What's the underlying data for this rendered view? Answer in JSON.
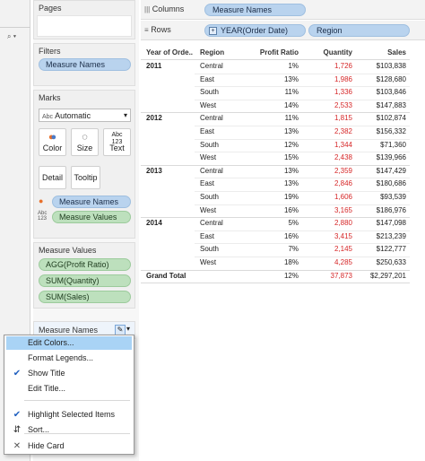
{
  "columns_shelf": {
    "label": "Columns",
    "pills": [
      "Measure Names"
    ]
  },
  "rows_shelf": {
    "label": "Rows",
    "pills": [
      "YEAR(Order Date)",
      "Region"
    ]
  },
  "cards": {
    "pages": {
      "title": "Pages"
    },
    "filters": {
      "title": "Filters",
      "pills": [
        "Measure Names"
      ]
    },
    "marks": {
      "title": "Marks",
      "mark_type": "Automatic",
      "mark_type_prefix": "Abc",
      "buttons": [
        "Color",
        "Size",
        "Text",
        "Detail",
        "Tooltip"
      ],
      "fields": [
        {
          "icon": "color-icon",
          "name": "Measure Names",
          "kind": "blue"
        },
        {
          "icon": "abc-icon",
          "name": "Measure Values",
          "kind": "green"
        }
      ]
    },
    "measure_values": {
      "title": "Measure Values",
      "pills": [
        "AGG(Profit Ratio)",
        "SUM(Quantity)",
        "SUM(Sales)"
      ]
    },
    "measure_names_legend": {
      "title": "Measure Names"
    }
  },
  "table": {
    "headers": [
      "Year of Orde..",
      "Region",
      "Profit Ratio",
      "Quantity",
      "Sales"
    ],
    "groups": [
      {
        "year": "2011",
        "rows": [
          {
            "region": "Central",
            "profit": "1%",
            "qty": "1,726",
            "sales": "$103,838"
          },
          {
            "region": "East",
            "profit": "13%",
            "qty": "1,986",
            "sales": "$128,680"
          },
          {
            "region": "South",
            "profit": "11%",
            "qty": "1,336",
            "sales": "$103,846"
          },
          {
            "region": "West",
            "profit": "14%",
            "qty": "2,533",
            "sales": "$147,883"
          }
        ]
      },
      {
        "year": "2012",
        "rows": [
          {
            "region": "Central",
            "profit": "11%",
            "qty": "1,815",
            "sales": "$102,874"
          },
          {
            "region": "East",
            "profit": "13%",
            "qty": "2,382",
            "sales": "$156,332"
          },
          {
            "region": "South",
            "profit": "12%",
            "qty": "1,344",
            "sales": "$71,360"
          },
          {
            "region": "West",
            "profit": "15%",
            "qty": "2,438",
            "sales": "$139,966"
          }
        ]
      },
      {
        "year": "2013",
        "rows": [
          {
            "region": "Central",
            "profit": "13%",
            "qty": "2,359",
            "sales": "$147,429"
          },
          {
            "region": "East",
            "profit": "13%",
            "qty": "2,846",
            "sales": "$180,686"
          },
          {
            "region": "South",
            "profit": "19%",
            "qty": "1,606",
            "sales": "$93,539"
          },
          {
            "region": "West",
            "profit": "16%",
            "qty": "3,165",
            "sales": "$186,976"
          }
        ]
      },
      {
        "year": "2014",
        "rows": [
          {
            "region": "Central",
            "profit": "5%",
            "qty": "2,880",
            "sales": "$147,098"
          },
          {
            "region": "East",
            "profit": "16%",
            "qty": "3,415",
            "sales": "$213,239"
          },
          {
            "region": "South",
            "profit": "7%",
            "qty": "2,145",
            "sales": "$122,777"
          },
          {
            "region": "West",
            "profit": "18%",
            "qty": "4,285",
            "sales": "$250,633"
          }
        ]
      }
    ],
    "grand_total": {
      "label": "Grand Total",
      "profit": "12%",
      "qty": "37,873",
      "sales": "$2,297,201"
    }
  },
  "context_menu": {
    "items": [
      {
        "label": "Edit Colors...",
        "icon": "",
        "highlighted": true
      },
      {
        "label": "Format Legends...",
        "icon": ""
      },
      {
        "label": "Show Title",
        "icon": "check-icon",
        "glyph": "✔"
      },
      {
        "label": "Edit Title...",
        "icon": ""
      },
      {
        "label": "Highlight Selected Items",
        "icon": "check-icon",
        "glyph": "✔"
      },
      {
        "label": "Sort...",
        "icon": "sort-icon",
        "glyph": "⇵"
      },
      {
        "label": "Hide Card",
        "icon": "close-icon",
        "glyph": "✕"
      }
    ]
  }
}
